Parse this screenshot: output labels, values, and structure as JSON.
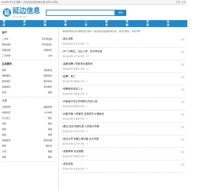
{
  "topbar": {
    "left": "2020年1月11日 星期一 | 欢迎您访问延边信息网 本月22日营业",
    "right": "登录 | 注册"
  },
  "logo": {
    "mark": "延",
    "name": "延边信息",
    "url": "www.yb0k.com"
  },
  "search": {
    "placeholder": "",
    "button": "搜索"
  },
  "nav": [
    "首页",
    "房产",
    "招聘",
    "求职",
    "二手",
    "服务",
    "车辆",
    "宠物",
    "生活"
  ],
  "sidebar": {
    "groups": [
      {
        "title": "房产",
        "rows": [
          [
            "二手房",
            "写字楼出租"
          ],
          [
            "租房出租",
            "写字楼出售"
          ],
          [
            "商铺出租",
            "商铺出售"
          ],
          [
            "厂房仓库",
            "土地"
          ]
        ]
      },
      {
        "title": "生活服务",
        "rows": [
          [
            "搬家",
            "家政保洁"
          ],
          [
            "维修服务",
            "装修建材"
          ],
          [
            "婚庆摄影",
            "教育培训"
          ],
          [
            "运输物流",
            "商务服务"
          ],
          [
            "旅游",
            "宠物"
          ]
        ]
      },
      {
        "title": "人才",
        "rows": [
          [
            "全职招聘",
            "兼职招聘"
          ],
          [
            "求职简历",
            "人才市场"
          ],
          [
            "普工技工",
            "销售"
          ],
          [
            "司机",
            "餐饮"
          ],
          [
            "保洁",
            "其他"
          ],
          [
            "家政",
            "保姆"
          ],
          [
            "快递物流",
            "物流仓储"
          ],
          [
            "厨师",
            "服务员"
          ],
          [
            "文员",
            "美容"
          ],
          [
            "美发",
            "健身"
          ]
        ]
      }
    ]
  },
  "notice": {
    "text": "本站所有信息均为网友自行发布，信息真实性由发布者负责，请自行辨别。",
    "link": "免责声明"
  },
  "posts": [
    {
      "title": "•转让求职",
      "meta": "延边信息网  房产类  浏览：23",
      "date": "今天"
    },
    {
      "title": "•市一中附近，出让小学、初中学区房",
      "meta": "延边信息网  房产类  浏览：15",
      "date": "今天"
    },
    {
      "title": "•高薪诚聘小学数学补课老师",
      "meta": "延边信息网  招聘类  浏览：12",
      "date": "今天"
    },
    {
      "title": "•招聘！美工",
      "meta": "延边信息网  招聘类  浏览：9",
      "date": "今天"
    },
    {
      "title": "•现聘临时保洁工人",
      "meta": "延边信息网  招聘类  浏览：8",
      "date": "今天"
    },
    {
      "title": "•河南省平安大学有限公司办公室",
      "meta": "延边信息网  服务类  浏览：7",
      "date": "今天"
    },
    {
      "title": "•出租车辆 小型客车 含驾驶员 价格面议",
      "meta": "延边信息网  车辆类  浏览：6",
      "date": "今天"
    },
    {
      "title": "•盈石 延边 现房出售 公积金可贷款",
      "meta": "延边信息网  房产类  浏览：5",
      "date": "今天"
    },
    {
      "title": "•延边大学 新建公寓出租 近大学城",
      "meta": "延边信息网  房产类  浏览：5",
      "date": "今天"
    },
    {
      "title": "•宠物寄养 全天照看",
      "meta": "延边信息网  宠物类  浏览：4",
      "date": "今天"
    },
    {
      "title": "•求实信息",
      "meta": "延边信息网  生活类  浏览：3",
      "date": "今天"
    }
  ]
}
